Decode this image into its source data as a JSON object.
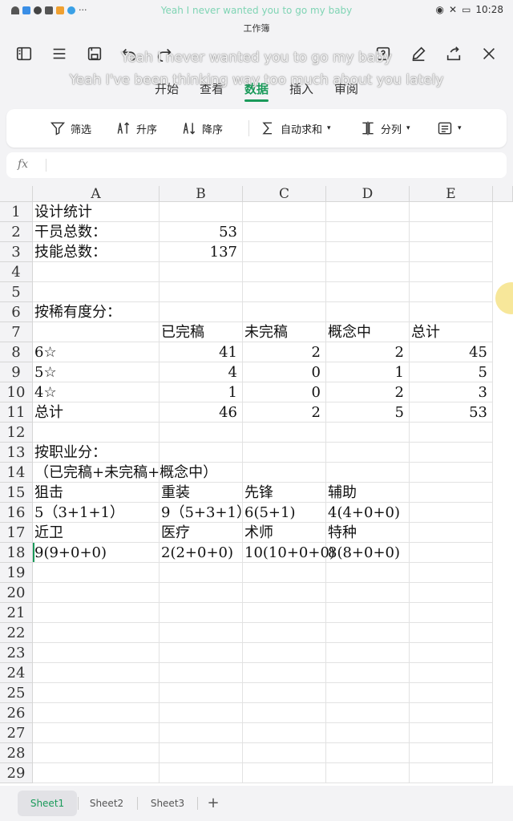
{
  "status": {
    "lyric_now": "Yeah I never wanted you to go my baby",
    "time": "10:28"
  },
  "doc_title": "工作簿",
  "lyrics": {
    "line1": "Yeah I never wanted you to go my baby",
    "line2": "Yeah I've been thinking way too much about you lately"
  },
  "tabs": [
    "开始",
    "查看",
    "数据",
    "插入",
    "审阅"
  ],
  "ribbon": {
    "filter": "筛选",
    "sort_asc": "升序",
    "sort_desc": "降序",
    "autosum": "自动求和",
    "split": "分列"
  },
  "formula": {
    "fx": "fx"
  },
  "columns": [
    "A",
    "B",
    "C",
    "D",
    "E"
  ],
  "rows": [
    "1",
    "2",
    "3",
    "4",
    "5",
    "6",
    "7",
    "8",
    "9",
    "10",
    "11",
    "12",
    "13",
    "14",
    "15",
    "16",
    "17",
    "18",
    "19",
    "20",
    "21",
    "22",
    "23",
    "24",
    "25",
    "26",
    "27",
    "28",
    "29"
  ],
  "cells": {
    "A1": "设计统计",
    "A2": "干员总数：",
    "B2": "53",
    "A3": "技能总数：",
    "B3": "137",
    "A6": "按稀有度分：",
    "B7": "已完稿",
    "C7": "未完稿",
    "D7": "概念中",
    "E7": "总计",
    "A8": "6☆",
    "B8": "41",
    "C8": "2",
    "D8": "2",
    "E8": "45",
    "A9": "5☆",
    "B9": "4",
    "C9": "0",
    "D9": "1",
    "E9": "5",
    "A10": "4☆",
    "B10": "1",
    "C10": "0",
    "D10": "2",
    "E10": "3",
    "A11": "总计",
    "B11": "46",
    "C11": "2",
    "D11": "5",
    "E11": "53",
    "A13": "按职业分：",
    "A14": "（已完稿+未完稿+概念中）",
    "A15": "狙击",
    "B15": "重装",
    "C15": "先锋",
    "D15": "辅助",
    "A16": "5（3+1+1）",
    "B16": "9（5+3+1）",
    "C16": "6(5+1)",
    "D16": "4(4+0+0)",
    "A17": "近卫",
    "B17": "医疗",
    "C17": "术师",
    "D17": "特种",
    "A18": "9(9+0+0)",
    "B18": "2(2+0+0)",
    "C18": "10(10+0+0)",
    "D18": "8(8+0+0)"
  },
  "sheets": [
    "Sheet1",
    "Sheet2",
    "Sheet3"
  ],
  "add_sheet": "+",
  "colors": {
    "accent": "#1a9a5a"
  }
}
